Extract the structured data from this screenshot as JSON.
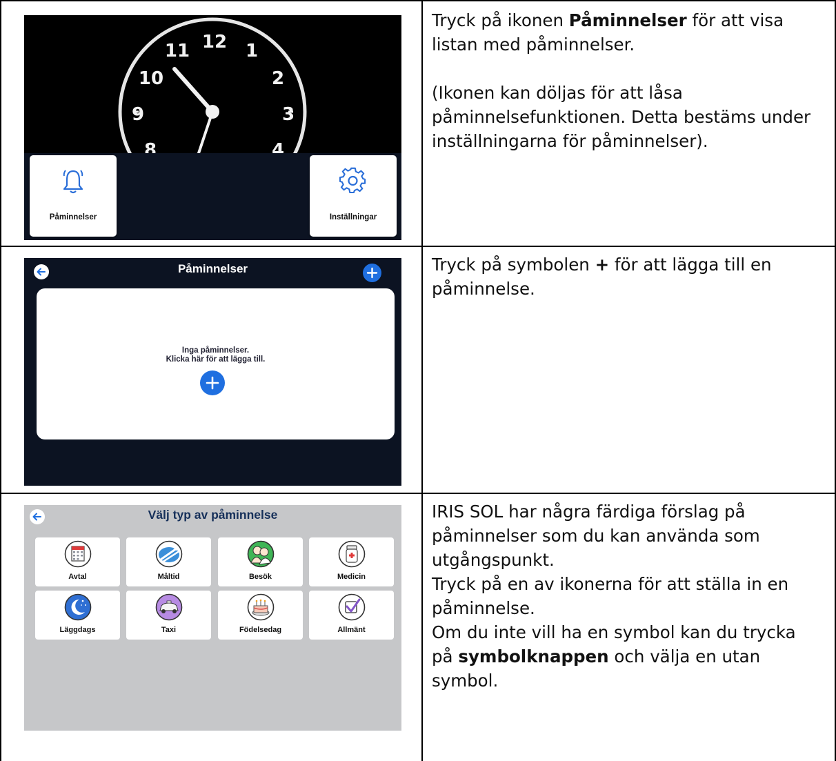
{
  "rows": [
    {
      "instruction": {
        "p1": {
          "before": "Tryck på ikonen ",
          "bold": "Påminnelser",
          "after": " för att visa listan med påminnelser."
        },
        "p2": "(Ikonen kan döljas för att låsa påminnelsefunktionen. Detta bestäms under inställningarna för påminnelser)."
      },
      "screenshot": {
        "clock_numbers": [
          "12",
          "1",
          "2",
          "3",
          "4",
          "8",
          "9",
          "10",
          "11"
        ],
        "reminders_label": "Påminnelser",
        "settings_label": "Inställningar",
        "reminders_icon": "bell-icon",
        "settings_icon": "gear-icon"
      }
    },
    {
      "instruction": {
        "before": "Tryck på symbolen ",
        "bold": "+",
        "after": " för att lägga till en påminnelse."
      },
      "screenshot": {
        "title": "Påminnelser",
        "empty_line1": "Inga påminnelser.",
        "empty_line2": "Klicka här för att lägga till.",
        "back_icon": "arrow-left-icon",
        "add_icon": "plus-icon"
      }
    },
    {
      "instruction": {
        "p1": "IRIS SOL har några färdiga förslag på påminnelser som du kan använda som utgångspunkt.",
        "p2": "Tryck på en av ikonerna för att ställa in en påminnelse.",
        "p3": {
          "before": "Om du inte vill ha en symbol kan du trycka på ",
          "bold": "symbolknappen",
          "after": " och välja en utan symbol."
        }
      },
      "screenshot": {
        "title": "Välj typ av påminnelse",
        "types": [
          {
            "label": "Avtal",
            "icon": "calendar-icon",
            "color": "#ffffff"
          },
          {
            "label": "Måltid",
            "icon": "cutlery-icon",
            "color": "#3b8fd9"
          },
          {
            "label": "Besök",
            "icon": "visitors-icon",
            "color": "#3fb556"
          },
          {
            "label": "Medicin",
            "icon": "medicine-jar-icon",
            "color": "#ffffff"
          },
          {
            "label": "Läggdags",
            "icon": "moon-icon",
            "color": "#2f6fd3"
          },
          {
            "label": "Taxi",
            "icon": "taxi-icon",
            "color": "#b78be3"
          },
          {
            "label": "Födelsedag",
            "icon": "cake-icon",
            "color": "#ffffff"
          },
          {
            "label": "Allmänt",
            "icon": "checkbox-icon",
            "color": "#ffffff"
          }
        ]
      }
    }
  ],
  "colors": {
    "accent_blue": "#1f6fe0",
    "dark_bg": "#0c1322",
    "title_navy": "#16305a",
    "panel_gray": "#c6c7c9"
  }
}
